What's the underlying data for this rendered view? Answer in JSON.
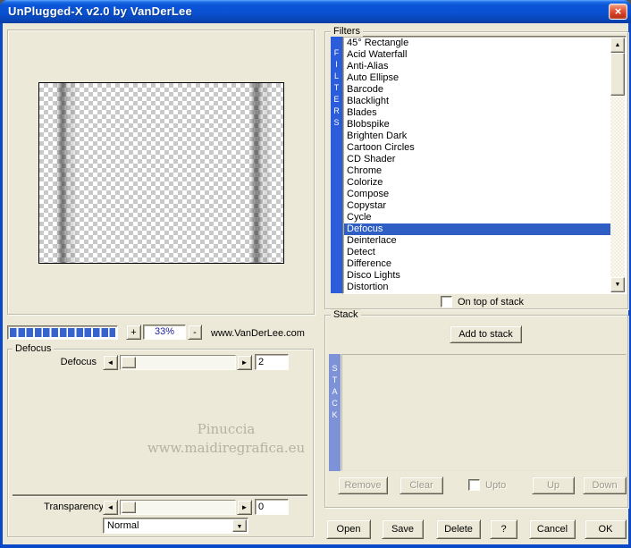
{
  "window": {
    "title": "UnPlugged-X v2.0 by VanDerLee",
    "close": "×"
  },
  "preview": {
    "zoom_in": "+",
    "zoom_out": "-",
    "zoom_level": "33%",
    "website": "www.VanDerLee.com",
    "watermark_line1": "Pinuccia",
    "watermark_line2": "www.maidiregrafica.eu"
  },
  "params": {
    "group": "Defocus",
    "sliders": [
      {
        "label": "Defocus",
        "value": "2"
      },
      {
        "label": "Transparency",
        "value": "0"
      }
    ],
    "blend_mode": "Normal"
  },
  "filters": {
    "group": "Filters",
    "vertical": "FILTERS",
    "selected": "Defocus",
    "on_top_label": "On top of stack",
    "items": [
      "45° Rectangle",
      "Acid Waterfall",
      "Anti-Alias",
      "Auto Ellipse",
      "Barcode",
      "Blacklight",
      "Blades",
      "Blobspike",
      "Brighten Dark",
      "Cartoon Circles",
      "CD Shader",
      "Chrome",
      "Colorize",
      "Compose",
      "Copystar",
      "Cycle",
      "Defocus",
      "Deinterlace",
      "Detect",
      "Difference",
      "Disco Lights",
      "Distortion"
    ]
  },
  "stack": {
    "group": "Stack",
    "vertical": "STACK",
    "add_button": "Add to stack",
    "remove_button": "Remove",
    "clear_button": "Clear",
    "upto_label": "Upto",
    "up_button": "Up",
    "down_button": "Down"
  },
  "footer": {
    "open": "Open",
    "save": "Save",
    "delete": "Delete",
    "help": "?",
    "cancel": "Cancel",
    "ok": "OK"
  },
  "icons": {
    "slider_left": "◄",
    "slider_right": "►",
    "scroll_up": "▲",
    "scroll_down": "▼",
    "dropdown_arrow": "▼"
  },
  "colors": {
    "titlebar_blue": "#0a51d3",
    "dialog_face": "#ece9d8",
    "selection_blue": "#2f5fc4",
    "filters_bar_blue": "#2b5cd9",
    "stack_bar_periwinkle": "#7e92d8",
    "progress_block_blue": "#3763cf",
    "zoom_text_blue": "#202099",
    "close_red": "#cf3c20"
  }
}
